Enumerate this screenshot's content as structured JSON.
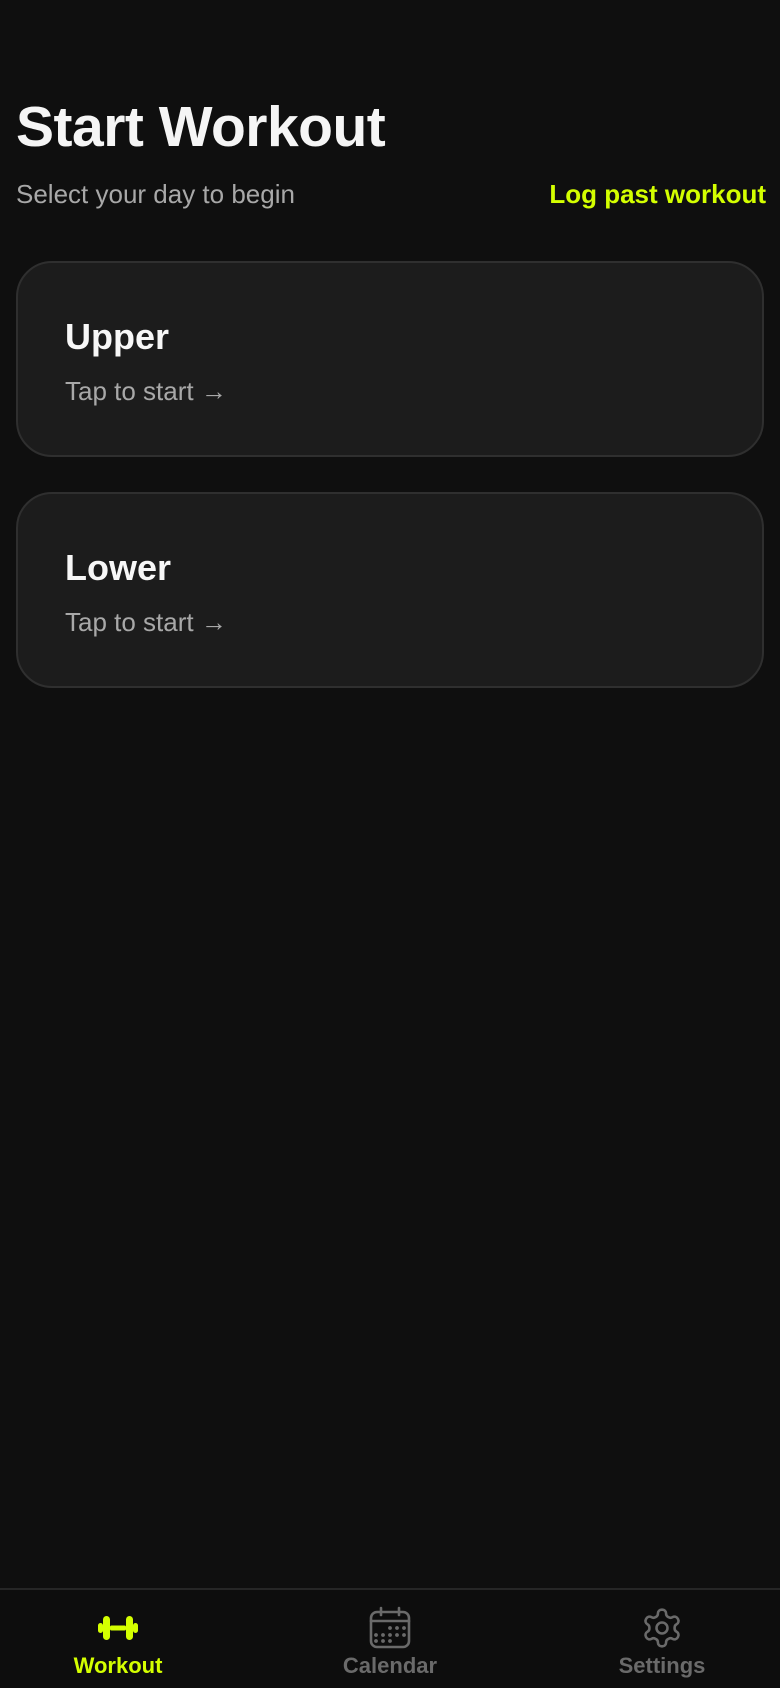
{
  "header": {
    "title": "Start Workout",
    "subtitle": "Select your day to begin",
    "log_past_label": "Log past workout"
  },
  "days": [
    {
      "name": "Upper",
      "hint": "Tap to start →"
    },
    {
      "name": "Lower",
      "hint": "Tap to start →"
    }
  ],
  "tabs": [
    {
      "label": "Workout",
      "icon": "dumbbell-icon",
      "active": true
    },
    {
      "label": "Calendar",
      "icon": "calendar-icon",
      "active": false
    },
    {
      "label": "Settings",
      "icon": "gear-icon",
      "active": false
    }
  ],
  "colors": {
    "background": "#0f0f0f",
    "card": "#1c1c1c",
    "accent": "#d4ff00",
    "muted": "#a8a8a8",
    "inactive_tab": "#6a6a6a"
  }
}
